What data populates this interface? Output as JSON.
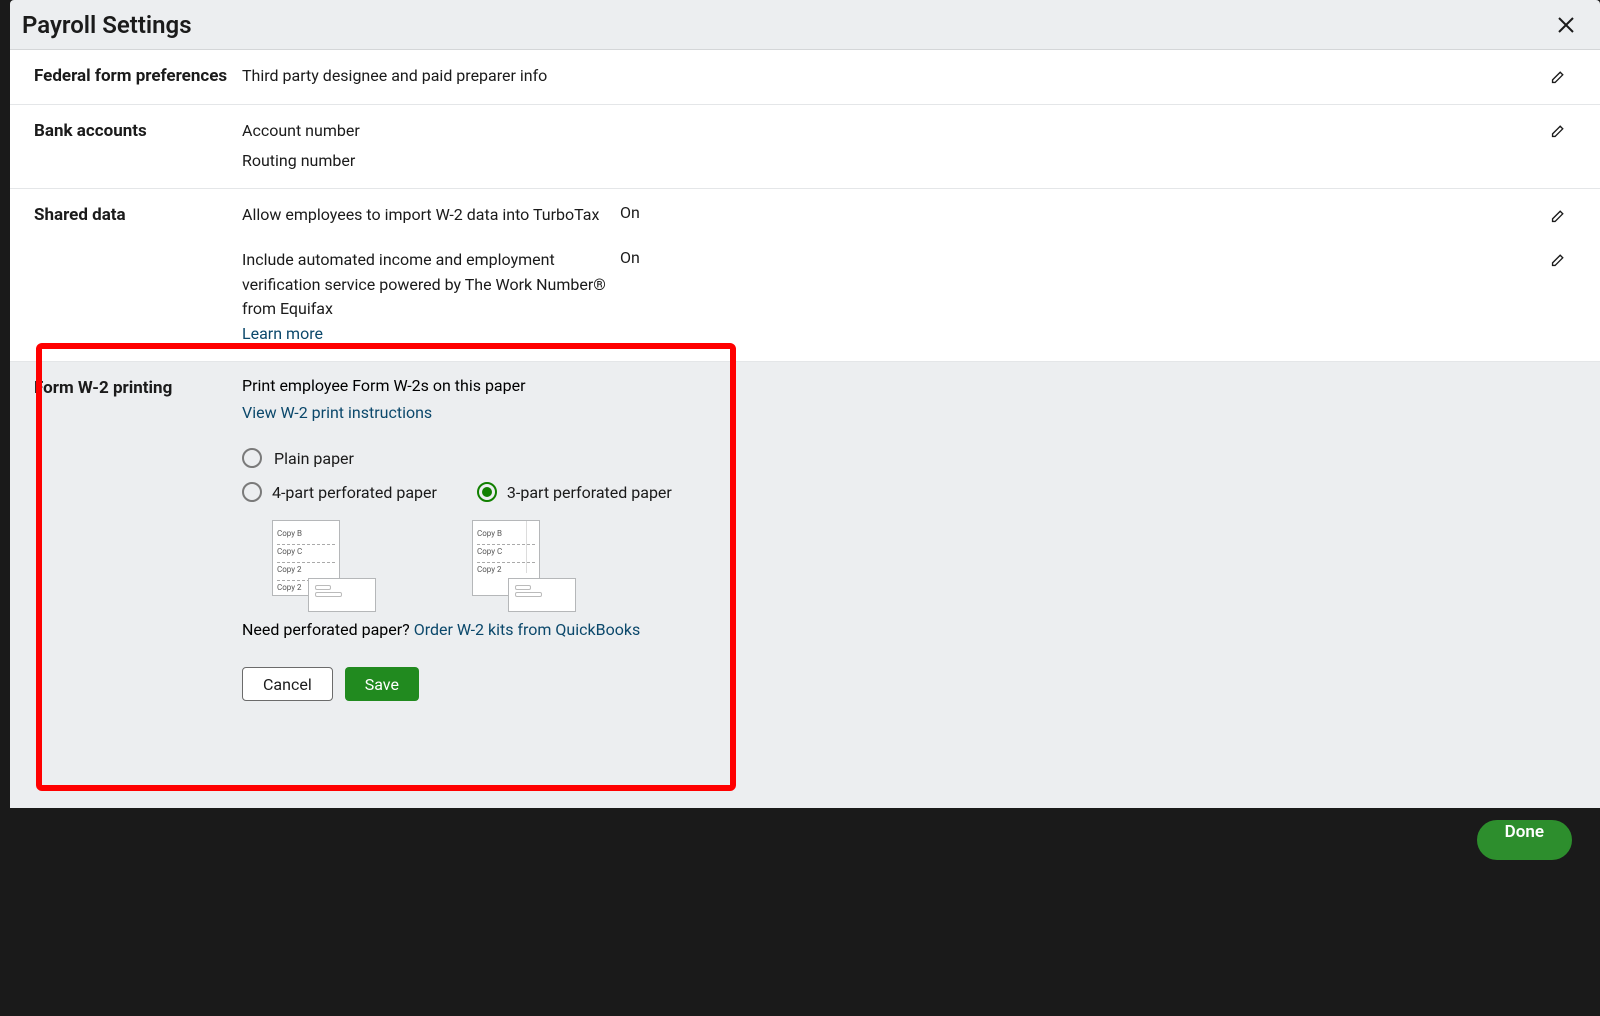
{
  "modal": {
    "title": "Payroll Settings"
  },
  "sections": {
    "federal": {
      "label": "Federal form preferences",
      "row1": "Third party designee and paid preparer info"
    },
    "bank": {
      "label": "Bank accounts",
      "row1": "Account number",
      "row2": "Routing number"
    },
    "shared": {
      "label": "Shared data",
      "row1_text": "Allow employees to import W-2 data into TurboTax",
      "row1_value": "On",
      "row2_text": "Include automated income and employment verification service powered by The Work Number® from Equifax",
      "row2_link": "Learn more",
      "row2_value": "On"
    },
    "w2": {
      "label": "Form W-2 printing",
      "prompt": "Print employee Form W-2s on this paper",
      "instructions_link": "View W-2 print instructions",
      "radio_plain": "Plain paper",
      "radio_4part": "4-part perforated paper",
      "radio_3part": "3-part perforated paper",
      "need_text": "Need perforated paper?  ",
      "order_link": "Order W-2 kits from QuickBooks",
      "cancel": "Cancel",
      "save": "Save",
      "preview_copyB": "Copy B",
      "preview_copyC": "Copy C",
      "preview_copy2": "Copy 2",
      "preview_copy2b": "Copy 2"
    }
  },
  "footer": {
    "done": "Done"
  }
}
